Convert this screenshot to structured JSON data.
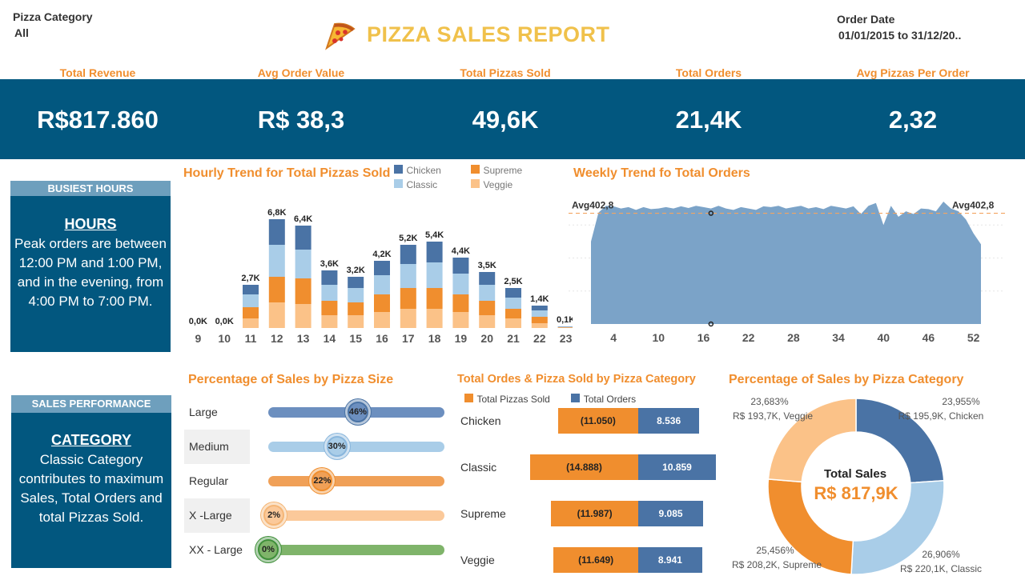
{
  "filters": {
    "category_label": "Pizza Category",
    "category_value": "All",
    "date_label": "Order Date",
    "date_value": "01/01/2015 to 31/12/20.."
  },
  "title": "PIZZA SALES REPORT",
  "kpis": [
    {
      "label": "Total Revenue",
      "value": "R$817.860"
    },
    {
      "label": "Avg Order Value",
      "value": "R$ 38,3"
    },
    {
      "label": "Total Pizzas Sold",
      "value": "49,6K"
    },
    {
      "label": "Total Orders",
      "value": "21,4K"
    },
    {
      "label": "Avg Pizzas Per Order",
      "value": "2,32"
    }
  ],
  "busiest": {
    "header": "BUSIEST HOURS",
    "subtitle": "HOURS",
    "text": "Peak orders are between 12:00 PM and 1:00 PM, and in the evening, from 4:00 PM to 7:00 PM."
  },
  "performance": {
    "header": "SALES PERFORMANCE",
    "subtitle": "CATEGORY",
    "text": "Classic Category contributes to maximum Sales, Total Orders and total Pizzas Sold."
  },
  "colors": {
    "chicken": "#4a73a5",
    "classic": "#a9cde8",
    "supreme": "#f08e2e",
    "veggie": "#fbc288",
    "area": "#7ba3c8",
    "navy": "#02577f"
  },
  "hourly": {
    "title": "Hourly Trend for Total Pizzas Sold",
    "legend": [
      "Chicken",
      "Supreme",
      "Classic",
      "Veggie"
    ],
    "chart_data": {
      "type": "bar",
      "stacked": true,
      "categories": [
        "9",
        "10",
        "11",
        "12",
        "13",
        "14",
        "15",
        "16",
        "17",
        "18",
        "19",
        "20",
        "21",
        "22",
        "23"
      ],
      "totals_label": [
        "0,0K",
        "0,0K",
        "2,7K",
        "6,8K",
        "6,4K",
        "3,6K",
        "3,2K",
        "4,2K",
        "5,2K",
        "5,4K",
        "4,4K",
        "3,5K",
        "2,5K",
        "1,4K",
        "0,1K"
      ],
      "series": [
        {
          "name": "Veggie",
          "values": [
            0,
            0,
            0.6,
            1.6,
            1.5,
            0.8,
            0.8,
            1.0,
            1.2,
            1.2,
            1.0,
            0.8,
            0.6,
            0.3,
            0.03
          ]
        },
        {
          "name": "Supreme",
          "values": [
            0,
            0,
            0.7,
            1.6,
            1.6,
            0.9,
            0.8,
            1.1,
            1.3,
            1.3,
            1.1,
            0.9,
            0.6,
            0.4,
            0.02
          ]
        },
        {
          "name": "Classic",
          "values": [
            0,
            0,
            0.8,
            2.0,
            1.8,
            1.0,
            0.9,
            1.2,
            1.5,
            1.6,
            1.3,
            1.0,
            0.7,
            0.4,
            0.03
          ]
        },
        {
          "name": "Chicken",
          "values": [
            0,
            0,
            0.6,
            1.6,
            1.5,
            0.9,
            0.7,
            0.9,
            1.2,
            1.3,
            1.0,
            0.8,
            0.6,
            0.3,
            0.02
          ]
        }
      ],
      "ylim": [
        0,
        7.5
      ]
    }
  },
  "weekly": {
    "title": "Weekly Trend fo Total Orders",
    "avg_label_left": "Avg402,8",
    "avg_label_right": "Avg402,8",
    "chart_data": {
      "type": "area",
      "x_ticks": [
        "4",
        "10",
        "16",
        "22",
        "28",
        "34",
        "40",
        "46",
        "52"
      ],
      "x": [
        1,
        2,
        3,
        4,
        5,
        6,
        7,
        8,
        9,
        10,
        11,
        12,
        13,
        14,
        15,
        16,
        17,
        18,
        19,
        20,
        21,
        22,
        23,
        24,
        25,
        26,
        27,
        28,
        29,
        30,
        31,
        32,
        33,
        34,
        35,
        36,
        37,
        38,
        39,
        40,
        41,
        42,
        43,
        44,
        45,
        46,
        47,
        48,
        49,
        50,
        51,
        52,
        53
      ],
      "values": [
        300,
        405,
        430,
        428,
        420,
        425,
        415,
        425,
        418,
        420,
        425,
        420,
        428,
        422,
        430,
        425,
        420,
        430,
        420,
        415,
        425,
        420,
        415,
        428,
        425,
        430,
        420,
        425,
        430,
        420,
        425,
        418,
        430,
        425,
        420,
        428,
        400,
        430,
        440,
        360,
        430,
        390,
        410,
        400,
        420,
        418,
        410,
        445,
        420,
        410,
        380,
        330,
        290
      ],
      "avg": 402.8,
      "ylim": [
        0,
        480
      ]
    }
  },
  "by_size": {
    "title": "Percentage of Sales by Pizza Size",
    "chart_data": {
      "type": "bar",
      "categories": [
        "Large",
        "Medium",
        "Regular",
        "X -Large",
        "XX - Large"
      ],
      "values": [
        46,
        30,
        22,
        2,
        0
      ],
      "labels": [
        "46%",
        "30%",
        "22%",
        "2%",
        "0%"
      ]
    }
  },
  "by_category": {
    "title": "Total Ordes & Pizza Sold by Pizza Category",
    "legend": [
      "Total Pizzas Sold",
      "Total Orders"
    ],
    "chart_data": {
      "type": "bar",
      "categories": [
        "Chicken",
        "Classic",
        "Supreme",
        "Veggie"
      ],
      "series": [
        {
          "name": "Total Pizzas Sold",
          "values": [
            11050,
            14888,
            11987,
            11649
          ],
          "labels": [
            "(11.050)",
            "(14.888)",
            "(11.987)",
            "(11.649)"
          ]
        },
        {
          "name": "Total Orders",
          "values": [
            8536,
            10859,
            9085,
            8941
          ],
          "labels": [
            "8.536",
            "10.859",
            "9.085",
            "8.941"
          ]
        }
      ]
    }
  },
  "donut": {
    "title": "Percentage of Sales by Pizza Category",
    "center_label": "Total Sales",
    "center_value": "R$ 817,9K",
    "chart_data": {
      "type": "pie",
      "categories": [
        "Chicken",
        "Classic",
        "Supreme",
        "Veggie"
      ],
      "values": [
        23.955,
        26.906,
        25.456,
        23.683
      ],
      "pct_labels": [
        "23,955%",
        "26,906%",
        "25,456%",
        "23,683%"
      ],
      "detail_labels": [
        "R$ 195,9K, Chicken",
        "R$ 220,1K, Classic",
        "R$ 208,2K, Supreme",
        "R$ 193,7K, Veggie"
      ]
    }
  }
}
